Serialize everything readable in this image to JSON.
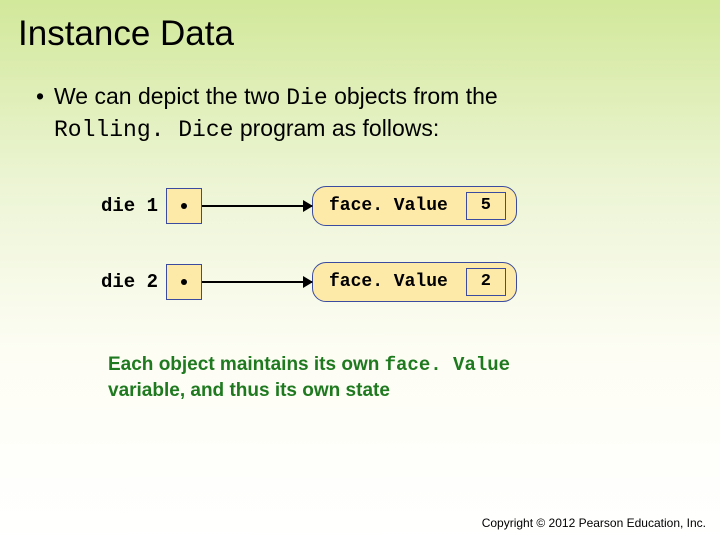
{
  "title": "Instance Data",
  "bullet": {
    "prefix": "•",
    "text_a": "We can depict the two ",
    "code_a": "Die",
    "text_b": " objects from the ",
    "code_b": "Rolling. Dice",
    "text_c": " program as follows:"
  },
  "diagram": {
    "rows": [
      {
        "var": "die 1",
        "field": "face. Value",
        "value": "5"
      },
      {
        "var": "die 2",
        "field": "face. Value",
        "value": "2"
      }
    ]
  },
  "caption": {
    "text_a": "Each object maintains its own ",
    "code_a": "face. Value",
    "text_b": " variable, and thus its own state"
  },
  "copyright": "Copyright © 2012 Pearson Education, Inc."
}
